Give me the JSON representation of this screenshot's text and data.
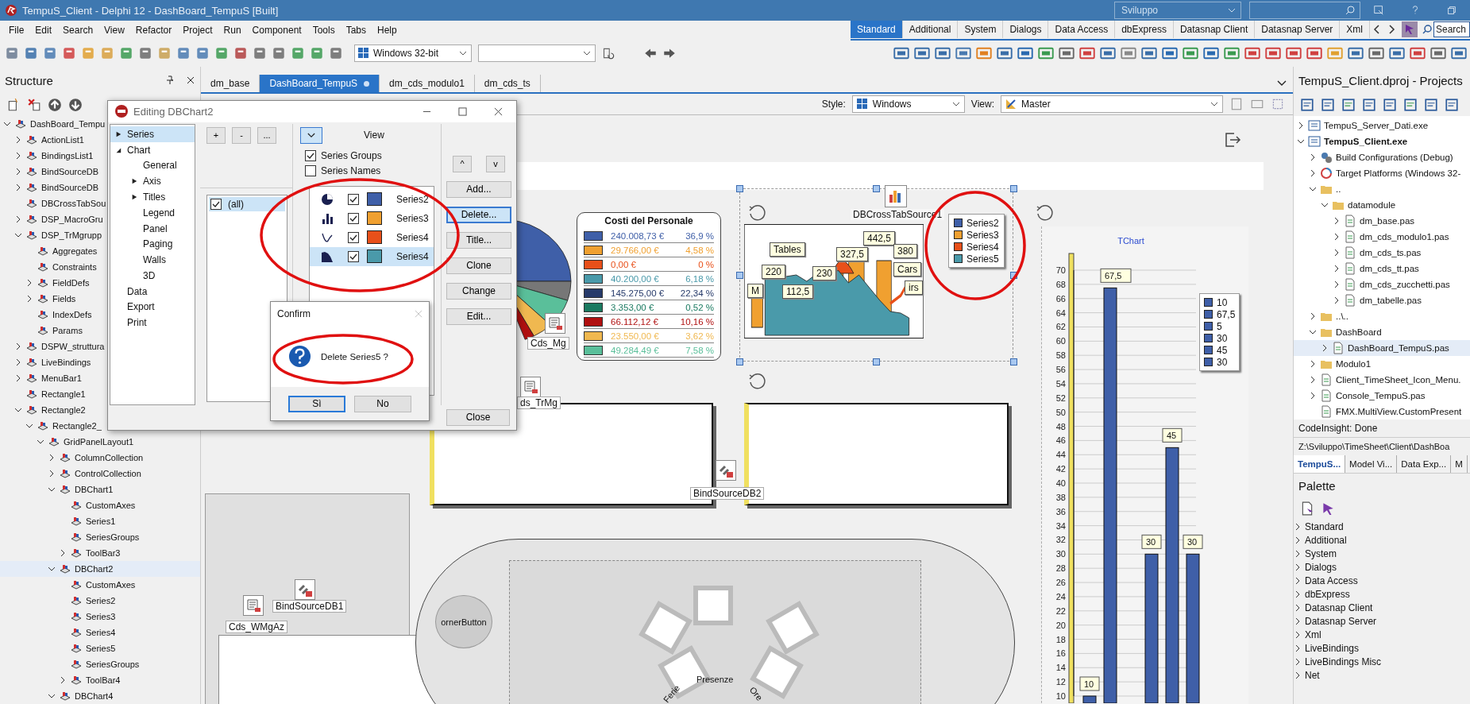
{
  "window": {
    "title": "TempuS_Client - Delphi 12 - DashBoard_TempuS [Built]",
    "layout_combo": "Sviluppo"
  },
  "menu": [
    "File",
    "Edit",
    "Search",
    "View",
    "Refactor",
    "Project",
    "Run",
    "Component",
    "Tools",
    "Tabs",
    "Help"
  ],
  "platform_combo": "Windows 32-bit",
  "palette_tabs": [
    {
      "label": "Standard",
      "selected": true
    },
    {
      "label": "Additional",
      "selected": false
    },
    {
      "label": "System",
      "selected": false
    },
    {
      "label": "Dialogs",
      "selected": false
    },
    {
      "label": "Data Access",
      "selected": false
    },
    {
      "label": "dbExpress",
      "selected": false
    },
    {
      "label": "Datasnap Client",
      "selected": false
    },
    {
      "label": "Datasnap Server",
      "selected": false
    },
    {
      "label": "Xml",
      "selected": false
    }
  ],
  "palette_search": {
    "placeholder": "Search"
  },
  "structure": {
    "title": "Structure",
    "tree": [
      {
        "label": "DashBoard_Tempu",
        "expanded": true,
        "selected": false,
        "children": [
          {
            "label": "ActionList1",
            "expanded": false,
            "selected": false
          },
          {
            "label": "BindingsList1",
            "expanded": false,
            "selected": false
          },
          {
            "label": "BindSourceDB",
            "expanded": false,
            "selected": false
          },
          {
            "label": "BindSourceDB",
            "expanded": false,
            "selected": false
          },
          {
            "label": "DBCrossTabSou",
            "selected": false
          },
          {
            "label": "DSP_MacroGru",
            "expanded": false,
            "selected": false
          },
          {
            "label": "DSP_TrMgrupp",
            "expanded": true,
            "selected": false,
            "children": [
              {
                "label": "Aggregates",
                "selected": false
              },
              {
                "label": "Constraints",
                "selected": false
              },
              {
                "label": "FieldDefs",
                "expanded": false,
                "selected": false
              },
              {
                "label": "Fields",
                "expanded": false,
                "selected": false
              },
              {
                "label": "IndexDefs",
                "selected": false
              },
              {
                "label": "Params",
                "selected": false
              }
            ]
          },
          {
            "label": "DSPW_struttura",
            "expanded": false,
            "selected": false
          },
          {
            "label": "LiveBindings",
            "expanded": false,
            "selected": false
          },
          {
            "label": "MenuBar1",
            "expanded": false,
            "selected": false
          },
          {
            "label": "Rectangle1",
            "selected": false
          },
          {
            "label": "Rectangle2",
            "expanded": true,
            "selected": false,
            "children": [
              {
                "label": "Rectangle2_",
                "expanded": true,
                "selected": false,
                "children": [
                  {
                    "label": "GridPanelLayout1",
                    "expanded": true,
                    "selected": false,
                    "children": [
                      {
                        "label": "ColumnCollection",
                        "expanded": false,
                        "selected": false
                      },
                      {
                        "label": "ControlCollection",
                        "expanded": false,
                        "selected": false
                      },
                      {
                        "label": "DBChart1",
                        "expanded": true,
                        "selected": false,
                        "children": [
                          {
                            "label": "CustomAxes",
                            "selected": false
                          },
                          {
                            "label": "Series1",
                            "selected": false
                          },
                          {
                            "label": "SeriesGroups",
                            "selected": false
                          },
                          {
                            "label": "ToolBar3",
                            "expanded": false,
                            "selected": false
                          }
                        ]
                      },
                      {
                        "label": "DBChart2",
                        "expanded": true,
                        "selected": true,
                        "children": [
                          {
                            "label": "CustomAxes",
                            "selected": false
                          },
                          {
                            "label": "Series2",
                            "selected": false
                          },
                          {
                            "label": "Series3",
                            "selected": false
                          },
                          {
                            "label": "Series4",
                            "selected": false
                          },
                          {
                            "label": "Series5",
                            "selected": false
                          },
                          {
                            "label": "SeriesGroups",
                            "selected": false
                          },
                          {
                            "label": "ToolBar4",
                            "expanded": false,
                            "selected": false
                          }
                        ]
                      },
                      {
                        "label": "DBChart4",
                        "expanded": true,
                        "selected": false
                      }
                    ]
                  }
                ]
              }
            ]
          }
        ]
      }
    ]
  },
  "editor_tabs": [
    {
      "label": "dm_base",
      "selected": false,
      "modified": false
    },
    {
      "label": "DashBoard_TempuS",
      "selected": true,
      "modified": true
    },
    {
      "label": "dm_cds_modulo1",
      "selected": false,
      "modified": false
    },
    {
      "label": "dm_cds_ts",
      "selected": false,
      "modified": false
    }
  ],
  "form_toolbar": {
    "style_label": "Style:",
    "style": "Windows",
    "view_label": "View:",
    "view": "Master"
  },
  "designer": {
    "pie_legend": {
      "title": "Costi del Personale",
      "rows": [
        {
          "color": "#3f5fa8",
          "amount": "240.008,73 €",
          "percent": "36,9 %"
        },
        {
          "color": "#f0a030",
          "amount": "29.766,00 €",
          "percent": "4,58 %"
        },
        {
          "color": "#e8501a",
          "amount": "0,00 €",
          "percent": "0 %"
        },
        {
          "color": "#4a9aaa",
          "amount": "40.200,00 €",
          "percent": "6,18 %"
        },
        {
          "color": "#263a6a",
          "amount": "145.275,00 €",
          "percent": "22,34 %"
        },
        {
          "color": "#1a7a60",
          "amount": "3.353,00 €",
          "percent": "0,52 %"
        },
        {
          "color": "#b01010",
          "amount": "66.112,12 €",
          "percent": "10,16 %"
        },
        {
          "color": "#f0b850",
          "amount": "23.550,00 €",
          "percent": "3,62 %"
        },
        {
          "color": "#5abf9a",
          "amount": "49.284,49 €",
          "percent": "7,58 %"
        }
      ]
    },
    "crosstab": {
      "source_label": "DBCrossTabSource1",
      "callouts": [
        "M",
        "220",
        "Tables",
        "112,5",
        "230",
        "327,5",
        "442,5",
        "380",
        "Cars",
        "irs"
      ],
      "legend": [
        {
          "label": "Series2",
          "color": "#3f5fa8"
        },
        {
          "label": "Series3",
          "color": "#f0a030"
        },
        {
          "label": "Series4",
          "color": "#e8501a"
        },
        {
          "label": "Series5",
          "color": "#4a9aaa"
        }
      ]
    },
    "tchart": {
      "chart_data": {
        "type": "bar",
        "title": "TChart",
        "series": [
          {
            "color": "#3f5fa8",
            "values": [
              10,
              67.5,
              null,
              30,
              45,
              30
            ]
          }
        ],
        "ylim": [
          10,
          70
        ],
        "grid": true,
        "yticks": [
          10,
          12,
          14,
          16,
          18,
          20,
          22,
          24,
          26,
          28,
          30,
          32,
          34,
          36,
          38,
          40,
          42,
          44,
          46,
          48,
          50,
          52,
          54,
          56,
          58,
          60,
          62,
          64,
          66,
          68,
          70
        ],
        "value_labels": [
          "10",
          "67,5",
          null,
          "30",
          "45",
          "30"
        ]
      },
      "legend": [
        "10",
        "67,5",
        "5",
        "30",
        "45",
        "30"
      ]
    },
    "components": [
      {
        "kind": "dataset",
        "label": "Cds_Mg"
      },
      {
        "kind": "dataset",
        "label": "ds_TrMg"
      },
      {
        "kind": "binding",
        "label": "BindSourceDB2"
      },
      {
        "kind": "binding",
        "label": "BindSourceDB1"
      },
      {
        "kind": "dataset",
        "label": "Cds_WMgAz"
      }
    ],
    "corner_button": "ornerButton",
    "ring_labels": [
      "Presenze",
      "Ferie",
      "Ore"
    ]
  },
  "chart_editor": {
    "title": "Editing DBChart2",
    "nav": [
      {
        "label": "Series",
        "expanded": false,
        "selected": true
      },
      {
        "label": "Chart",
        "expanded": true,
        "selected": false,
        "children": [
          {
            "label": "General",
            "selected": false
          },
          {
            "label": "Axis",
            "expanded": false,
            "selected": false
          },
          {
            "label": "Titles",
            "expanded": false,
            "selected": false
          },
          {
            "label": "Legend",
            "selected": false
          },
          {
            "label": "Panel",
            "selected": false
          },
          {
            "label": "Paging",
            "selected": false
          },
          {
            "label": "Walls",
            "selected": false
          },
          {
            "label": "3D",
            "selected": false
          }
        ]
      },
      {
        "label": "Data",
        "selected": false
      },
      {
        "label": "Export",
        "selected": false
      },
      {
        "label": "Print",
        "selected": false
      }
    ],
    "group_buttons": [
      "+",
      "-",
      "..."
    ],
    "groups": [
      {
        "label": "(all)",
        "checked": true,
        "selected": true
      }
    ],
    "view_label": "View",
    "options": [
      {
        "label": "Series Groups",
        "checked": true
      },
      {
        "label": "Series Names",
        "checked": false
      }
    ],
    "series": [
      {
        "kind": "pie",
        "checked": true,
        "color": "#3f5fa8",
        "name": "Series2",
        "selected": false
      },
      {
        "kind": "bar",
        "checked": true,
        "color": "#f0a030",
        "name": "Series3",
        "selected": false
      },
      {
        "kind": "line",
        "checked": true,
        "color": "#e8501a",
        "name": "Series4",
        "selected": false
      },
      {
        "kind": "area",
        "checked": true,
        "color": "#4a9aaa",
        "name": "Series4",
        "selected": true
      }
    ],
    "order_buttons": [
      "^",
      "v"
    ],
    "actions": [
      {
        "label": "Add...",
        "selected": false
      },
      {
        "label": "Delete...",
        "selected": true
      },
      {
        "label": "Title...",
        "selected": false
      },
      {
        "label": "Clone",
        "selected": false
      },
      {
        "label": "Change",
        "selected": false
      },
      {
        "label": "Edit...",
        "selected": false
      }
    ],
    "close": "Close"
  },
  "confirm": {
    "title": "Confirm",
    "message": "Delete Series5 ?",
    "buttons": [
      {
        "label": "Sì",
        "default": true
      },
      {
        "label": "No",
        "default": false
      }
    ]
  },
  "projects": {
    "title": "TempuS_Client.dproj - Projects",
    "tree": [
      {
        "label": "TempuS_Server_Dati.exe",
        "kind": "exe",
        "active": false,
        "expanded": false,
        "selected": false
      },
      {
        "label": "TempuS_Client.exe",
        "kind": "exe",
        "active": true,
        "expanded": true,
        "selected": false,
        "children": [
          {
            "label": "Build Configurations (Debug)",
            "kind": "config",
            "expanded": false,
            "selected": false
          },
          {
            "label": "Target Platforms (Windows 32-",
            "kind": "platform",
            "expanded": false,
            "selected": false
          },
          {
            "label": "..",
            "kind": "folder",
            "expanded": true,
            "selected": false,
            "children": [
              {
                "label": "datamodule",
                "kind": "folder",
                "expanded": true,
                "selected": false,
                "children": [
                  {
                    "label": "dm_base.pas",
                    "kind": "file",
                    "expanded": false,
                    "selected": false
                  },
                  {
                    "label": "dm_cds_modulo1.pas",
                    "kind": "file",
                    "expanded": false,
                    "selected": false
                  },
                  {
                    "label": "dm_cds_ts.pas",
                    "kind": "file",
                    "expanded": false,
                    "selected": false
                  },
                  {
                    "label": "dm_cds_tt.pas",
                    "kind": "file",
                    "expanded": false,
                    "selected": false
                  },
                  {
                    "label": "dm_cds_zucchetti.pas",
                    "kind": "file",
                    "expanded": false,
                    "selected": false
                  },
                  {
                    "label": "dm_tabelle.pas",
                    "kind": "file",
                    "expanded": false,
                    "selected": false
                  }
                ]
              }
            ]
          },
          {
            "label": "..\\..",
            "kind": "folder",
            "expanded": false,
            "selected": false
          },
          {
            "label": "DashBoard",
            "kind": "folder",
            "expanded": true,
            "selected": false,
            "children": [
              {
                "label": "DashBoard_TempuS.pas",
                "kind": "file",
                "expanded": false,
                "selected": true
              }
            ]
          },
          {
            "label": "Modulo1",
            "kind": "folder",
            "expanded": false,
            "selected": false
          },
          {
            "label": "Client_TimeSheet_Icon_Menu.",
            "kind": "file",
            "expanded": false,
            "selected": false
          },
          {
            "label": "Console_TempuS.pas",
            "kind": "file",
            "expanded": false,
            "selected": false
          },
          {
            "label": "FMX.MultiView.CustomPresent",
            "kind": "file",
            "selected": false
          }
        ]
      }
    ]
  },
  "status": "CodeInsight: Done",
  "path": "Z:\\Sviluppo\\TimeSheet\\Client\\DashBoa",
  "panel_tabs": [
    {
      "label": "TempuS...",
      "selected": true
    },
    {
      "label": "Model Vi...",
      "selected": false
    },
    {
      "label": "Data Exp...",
      "selected": false
    },
    {
      "label": "M",
      "selected": false
    }
  ],
  "palette": {
    "title": "Palette",
    "categories": [
      "Standard",
      "Additional",
      "System",
      "Dialogs",
      "Data Access",
      "dbExpress",
      "Datasnap Client",
      "Datasnap Server",
      "Xml",
      "LiveBindings",
      "LiveBindings Misc",
      "Net"
    ]
  }
}
